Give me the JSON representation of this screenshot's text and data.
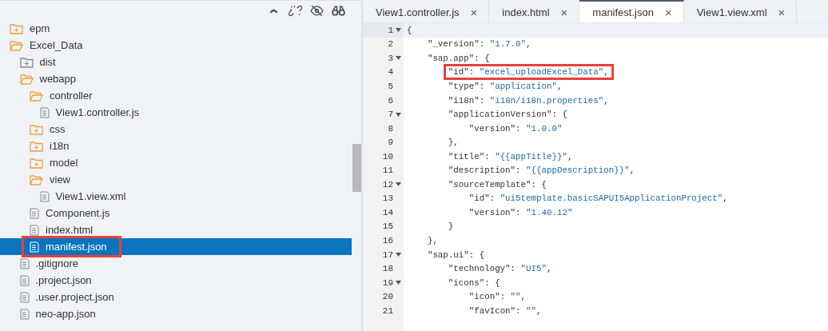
{
  "explorer": {
    "tree": [
      {
        "label": "epm",
        "kind": "folder",
        "expanded": false,
        "selected": false
      },
      {
        "label": "Excel_Data",
        "kind": "folder",
        "expanded": true,
        "selected": false,
        "children": [
          {
            "label": "dist",
            "kind": "build-folder",
            "expanded": false,
            "selected": false
          },
          {
            "label": "webapp",
            "kind": "folder",
            "expanded": true,
            "selected": false,
            "children": [
              {
                "label": "controller",
                "kind": "folder",
                "expanded": true,
                "selected": false,
                "children": [
                  {
                    "label": "View1.controller.js",
                    "kind": "file",
                    "selected": false
                  }
                ]
              },
              {
                "label": "css",
                "kind": "folder",
                "expanded": false,
                "selected": false
              },
              {
                "label": "i18n",
                "kind": "folder",
                "expanded": false,
                "selected": false
              },
              {
                "label": "model",
                "kind": "folder",
                "expanded": false,
                "selected": false
              },
              {
                "label": "view",
                "kind": "folder",
                "expanded": true,
                "selected": false,
                "children": [
                  {
                    "label": "View1.view.xml",
                    "kind": "file",
                    "selected": false
                  }
                ]
              },
              {
                "label": "Component.js",
                "kind": "file",
                "selected": false
              },
              {
                "label": "index.html",
                "kind": "file",
                "selected": false
              },
              {
                "label": "manifest.json",
                "kind": "file",
                "selected": true,
                "highlighted": true
              }
            ]
          },
          {
            "label": ".gitignore",
            "kind": "file",
            "selected": false
          },
          {
            "label": ".project.json",
            "kind": "file",
            "selected": false
          },
          {
            "label": ".user.project.json",
            "kind": "file",
            "selected": false
          },
          {
            "label": "neo-app.json",
            "kind": "file",
            "selected": false
          }
        ]
      }
    ]
  },
  "editor": {
    "tabs": [
      {
        "label": "View1.controller.js",
        "selected": false,
        "close": "×"
      },
      {
        "label": "index.html",
        "selected": false,
        "close": "×"
      },
      {
        "label": "manifest.json",
        "selected": true,
        "close": "×"
      },
      {
        "label": "View1.view.xml",
        "selected": false,
        "close": "×"
      }
    ],
    "lines": [
      {
        "number": "1",
        "text": "{",
        "foldable": true,
        "active": true
      },
      {
        "number": "2",
        "text": "    \"_version\": \"1.7.0\",",
        "foldable": false,
        "active": false
      },
      {
        "number": "3",
        "text": "    \"sap.app\": {",
        "foldable": true,
        "active": false
      },
      {
        "number": "4",
        "text": "        \"id\": \"excel_uploadExcel_Data\",",
        "foldable": false,
        "active": false,
        "highlighted": true
      },
      {
        "number": "5",
        "text": "        \"type\": \"application\",",
        "foldable": false,
        "active": false
      },
      {
        "number": "6",
        "text": "        \"i18n\": \"i18n/i18n.properties\",",
        "foldable": false,
        "active": false
      },
      {
        "number": "7",
        "text": "        \"applicationVersion\": {",
        "foldable": true,
        "active": false
      },
      {
        "number": "8",
        "text": "            \"version\": \"1.0.0\"",
        "foldable": false,
        "active": false
      },
      {
        "number": "9",
        "text": "        },",
        "foldable": false,
        "active": false
      },
      {
        "number": "10",
        "text": "        \"title\": \"{{appTitle}}\",",
        "foldable": false,
        "active": false
      },
      {
        "number": "11",
        "text": "        \"description\": \"{{appDescription}}\",",
        "foldable": false,
        "active": false
      },
      {
        "number": "12",
        "text": "        \"sourceTemplate\": {",
        "foldable": true,
        "active": false
      },
      {
        "number": "13",
        "text": "            \"id\": \"ui5template.basicSAPUI5ApplicationProject\",",
        "foldable": false,
        "active": false
      },
      {
        "number": "14",
        "text": "            \"version\": \"1.40.12\"",
        "foldable": false,
        "active": false
      },
      {
        "number": "15",
        "text": "        }",
        "foldable": false,
        "active": false
      },
      {
        "number": "16",
        "text": "    },",
        "foldable": false,
        "active": false
      },
      {
        "number": "17",
        "text": "    \"sap.ui\": {",
        "foldable": true,
        "active": false
      },
      {
        "number": "18",
        "text": "        \"technology\": \"UI5\",",
        "foldable": false,
        "active": false
      },
      {
        "number": "19",
        "text": "        \"icons\": {",
        "foldable": true,
        "active": false
      },
      {
        "number": "20",
        "text": "            \"icon\": \"\",",
        "foldable": false,
        "active": false
      },
      {
        "number": "21",
        "text": "            \"favIcon\": \"\",",
        "foldable": false,
        "active": false
      }
    ]
  }
}
